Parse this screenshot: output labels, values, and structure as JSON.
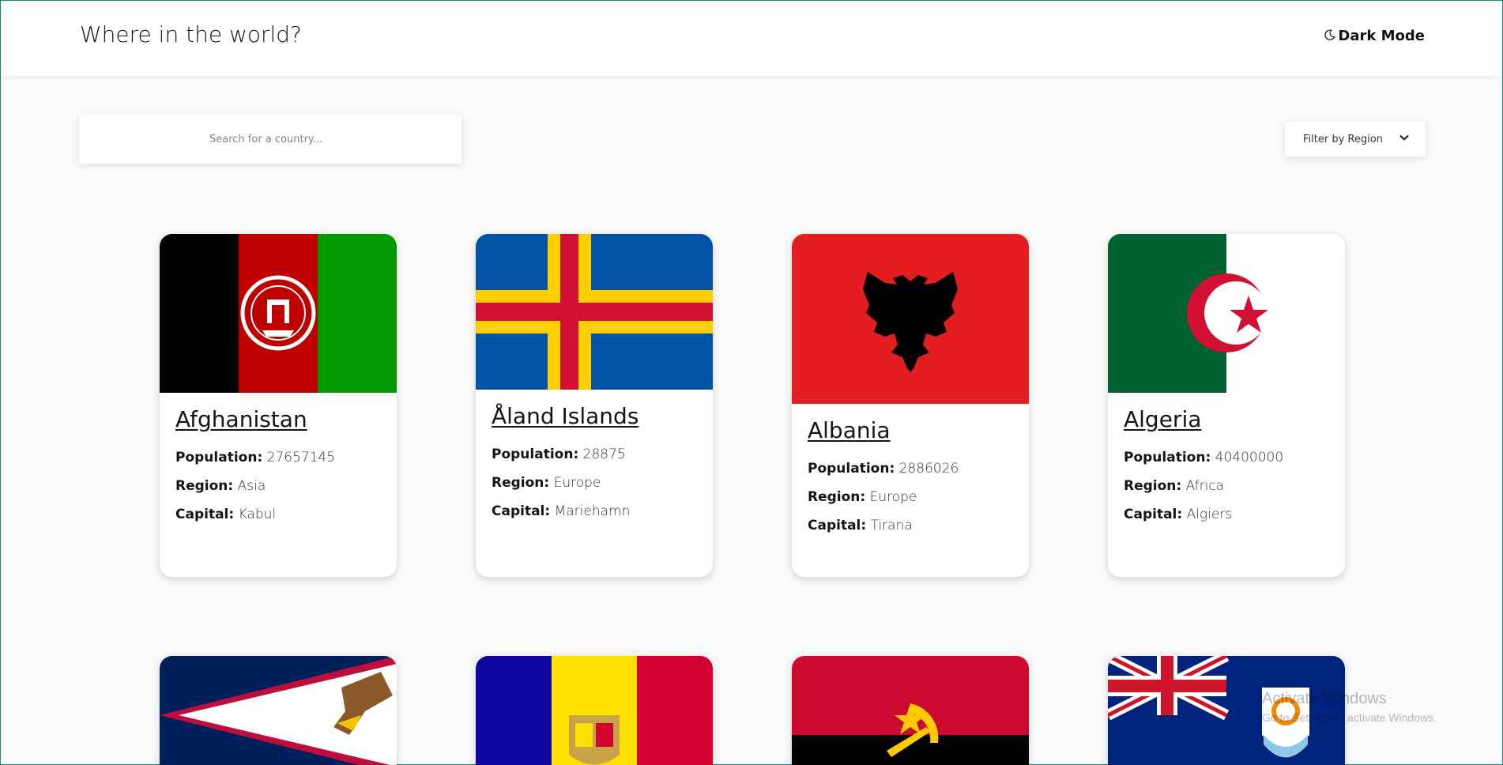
{
  "header": {
    "title": "Where in the world?",
    "dark_mode_label": "Dark Mode",
    "dark_mode_icon": "moon-icon"
  },
  "search": {
    "placeholder": "Search for a country...",
    "value": ""
  },
  "filter": {
    "label": "Filter by Region",
    "icon": "chevron-down-icon"
  },
  "labels": {
    "population": "Population:",
    "region": "Region:",
    "capital": "Capital:"
  },
  "countries": [
    {
      "name": "Afghanistan",
      "population": "27657145",
      "region": "Asia",
      "capital": "Kabul"
    },
    {
      "name": "Åland Islands",
      "population": "28875",
      "region": "Europe",
      "capital": "Mariehamn"
    },
    {
      "name": "Albania",
      "population": "2886026",
      "region": "Europe",
      "capital": "Tirana"
    },
    {
      "name": "Algeria",
      "population": "40400000",
      "region": "Africa",
      "capital": "Algiers"
    }
  ],
  "more_flags": [
    "american-samoa-flag",
    "andorra-flag",
    "angola-flag",
    "anguilla-flag"
  ],
  "watermark": {
    "line1": "Activate Windows",
    "line2": "Go to Settings to activate Windows."
  }
}
